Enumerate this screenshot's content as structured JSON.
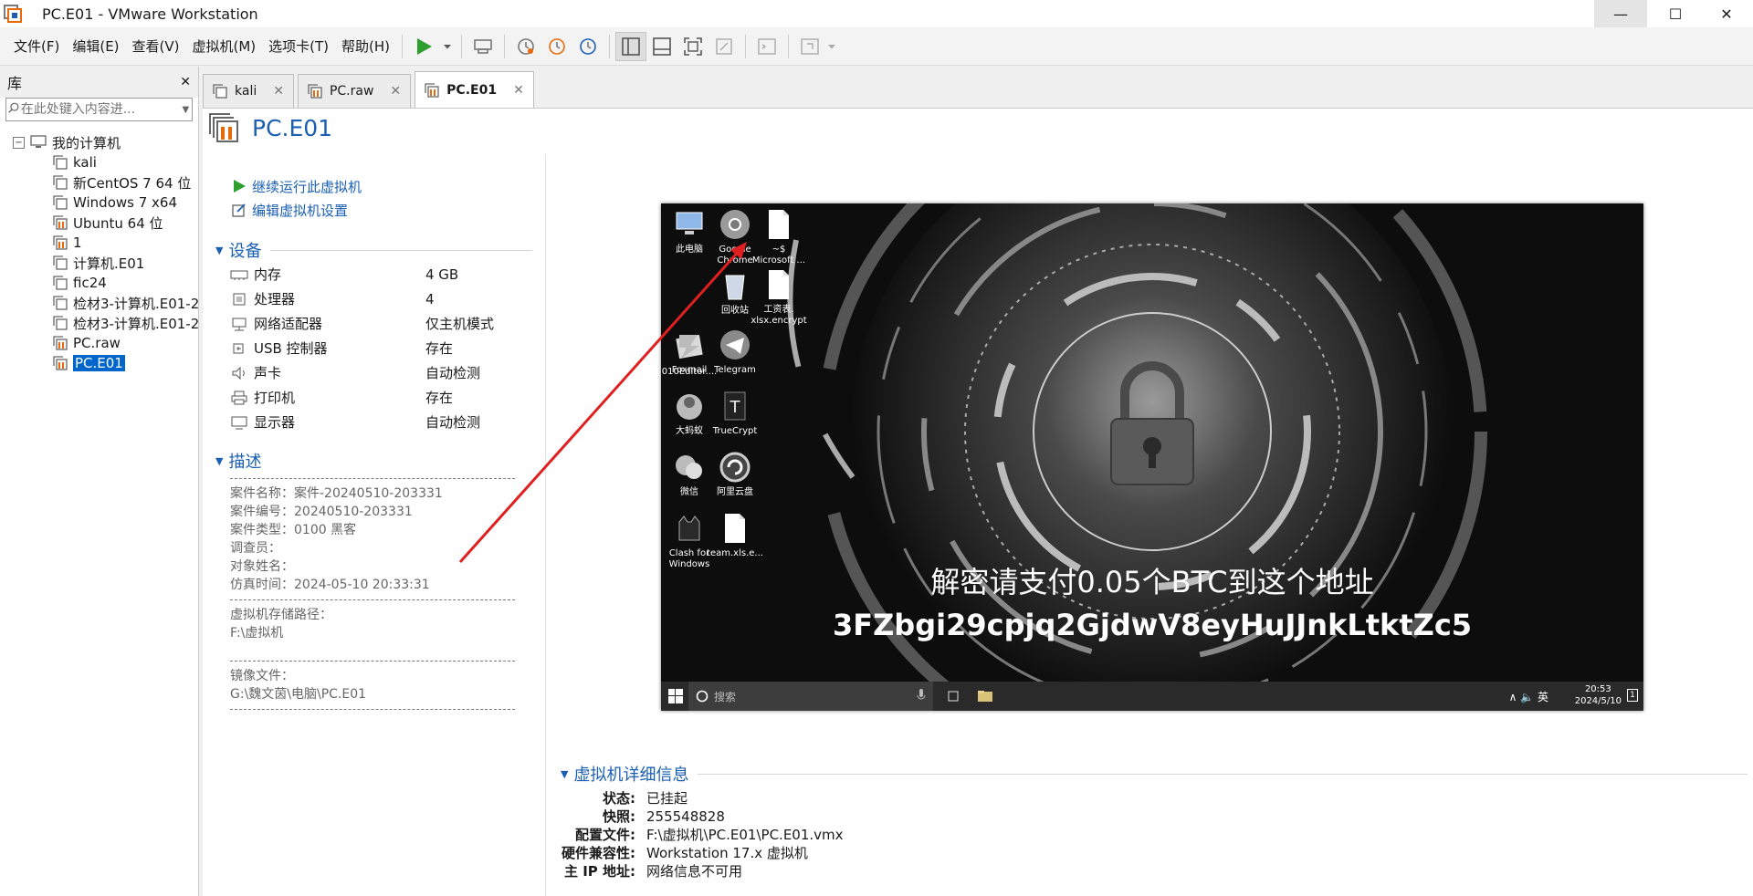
{
  "window": {
    "title": "PC.E01 - VMware Workstation",
    "minimize": "—",
    "maximize": "☐",
    "close": "✕"
  },
  "menu": [
    "文件(F)",
    "编辑(E)",
    "查看(V)",
    "虚拟机(M)",
    "选项卡(T)",
    "帮助(H)"
  ],
  "library": {
    "title": "库",
    "close": "✕",
    "search_placeholder": "在此处键入内容进...",
    "root": "我的计算机",
    "root_toggle": "−",
    "items": [
      {
        "label": "kali",
        "type": "plain"
      },
      {
        "label": "新CentOS 7 64 位",
        "type": "plain"
      },
      {
        "label": "Windows 7 x64",
        "type": "plain"
      },
      {
        "label": "Ubuntu 64 位",
        "type": "bars"
      },
      {
        "label": "1",
        "type": "bars"
      },
      {
        "label": "计算机.E01",
        "type": "plain"
      },
      {
        "label": "fic24",
        "type": "plain"
      },
      {
        "label": "检材3-计算机.E01-2",
        "type": "plain"
      },
      {
        "label": "检材3-计算机.E01-2",
        "type": "plain"
      },
      {
        "label": "PC.raw",
        "type": "bars"
      },
      {
        "label": "PC.E01",
        "type": "bars",
        "selected": true
      }
    ]
  },
  "tabs": [
    {
      "label": "kali",
      "close": "✕"
    },
    {
      "label": "PC.raw",
      "close": "✕"
    },
    {
      "label": "PC.E01",
      "close": "✕",
      "active": true
    }
  ],
  "vm": {
    "title": "PC.E01",
    "actions": [
      "继续运行此虚拟机",
      "编辑虚拟机设置"
    ],
    "devices_heading": "设备",
    "devices": [
      {
        "name": "内存",
        "value": "4 GB",
        "icon": "memory-icon"
      },
      {
        "name": "处理器",
        "value": "4",
        "icon": "cpu-icon"
      },
      {
        "name": "网络适配器",
        "value": "仅主机模式",
        "icon": "network-icon"
      },
      {
        "name": "USB 控制器",
        "value": "存在",
        "icon": "usb-icon"
      },
      {
        "name": "声卡",
        "value": "自动检测",
        "icon": "speaker-icon"
      },
      {
        "name": "打印机",
        "value": "存在",
        "icon": "printer-icon"
      },
      {
        "name": "显示器",
        "value": "自动检测",
        "icon": "monitor-icon"
      }
    ],
    "description_heading": "描述",
    "description": {
      "block1": [
        "案件名称：案件-20240510-203331",
        "案件编号：20240510-203331",
        "案件类型：0100 黑客",
        "调查员：",
        "对象姓名：",
        "仿真时间：2024-05-10 20:33:31"
      ],
      "block2": [
        "虚拟机存储路径：",
        "F:\\虚拟机"
      ],
      "block3": [
        "镜像文件：",
        "G:\\魏文茵\\电脑\\PC.E01"
      ]
    },
    "details_heading": "虚拟机详细信息",
    "details": [
      {
        "key": "状态:",
        "value": "已挂起"
      },
      {
        "key": "快照:",
        "value": "255548828"
      },
      {
        "key": "配置文件:",
        "value": "F:\\虚拟机\\PC.E01\\PC.E01.vmx"
      },
      {
        "key": "硬件兼容性:",
        "value": "Workstation 17.x 虚拟机"
      },
      {
        "key": "主 IP 地址:",
        "value": "网络信息不可用"
      }
    ]
  },
  "guest_screen": {
    "icons": [
      {
        "label": "此电脑",
        "icon": "this-pc-icon"
      },
      {
        "label": "Google Chrome",
        "icon": "chrome-icon"
      },
      {
        "label": "~$ Microsoft ...",
        "icon": "document-icon"
      },
      {
        "label": "回收站",
        "icon": "recycle-bin-icon"
      },
      {
        "label": "010Editor....",
        "icon": "editor-icon"
      },
      {
        "label": "工资表. xlsx.encrypt",
        "icon": "document-icon"
      },
      {
        "label": "Foxmail",
        "icon": "foxmail-icon"
      },
      {
        "label": "Telegram",
        "icon": "telegram-icon"
      },
      {
        "label": "大蚂蚁",
        "icon": "ant-icon"
      },
      {
        "label": "TrueCrypt",
        "icon": "truecrypt-icon"
      },
      {
        "label": "微信",
        "icon": "wechat-icon"
      },
      {
        "label": "阿里云盘",
        "icon": "aliyun-drive-icon"
      },
      {
        "label": "Clash for Windows",
        "icon": "clash-icon"
      },
      {
        "label": "team.xls.e...",
        "icon": "document-icon"
      }
    ],
    "ransom_line1": "解密请支付0.05个BTC到这个地址",
    "ransom_line2": "3FZbgi29cpjq2GjdwV8eyHuJJnkLtktZc5",
    "taskbar_search": "搜索",
    "tray": "∧ 🔈 英",
    "clock_time": "20:53",
    "clock_date": "2024/5/10",
    "notify_badge": "1"
  },
  "colors": {
    "accent": "#1a5fb4",
    "selection": "#0066cc",
    "play_green": "#2e9e2e",
    "vm_bars_orange": "#e8690c",
    "annotation_red": "#e02020"
  }
}
